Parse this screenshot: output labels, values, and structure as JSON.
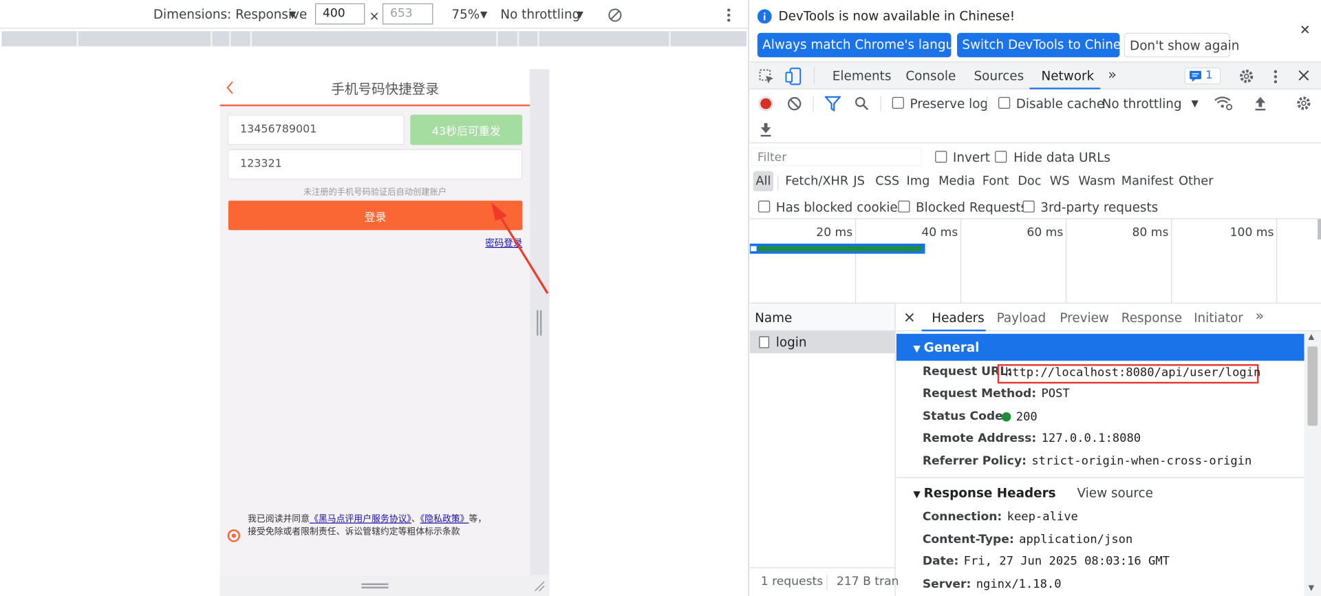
{
  "device_toolbar": {
    "dimensions_label": "Dimensions: Responsive",
    "width": "400",
    "height_placeholder": "653",
    "times": "×",
    "zoom": "75%",
    "throttling": "No throttling"
  },
  "mobile_page": {
    "title": "手机号码快捷登录",
    "phone": "13456789001",
    "resend_button": "43秒后可重发",
    "code": "123321",
    "hint": "未注册的手机号码验证后自动创建账户",
    "login_button": "登录",
    "password_login_link": "密码登录",
    "agreement": {
      "prefix": "我已阅读并同意",
      "link1": "《黑马点评用户服务协议》",
      "sep": "、",
      "link2": "《隐私政策》",
      "suffix": "等，",
      "line2": "接受免除或者限制责任、诉讼管辖约定等粗体标示条款"
    }
  },
  "devtools": {
    "notice": {
      "text": "DevTools is now available in Chinese!",
      "btn_match": "Always match Chrome's language",
      "btn_switch": "Switch DevTools to Chinese",
      "btn_dismiss": "Don't show again"
    },
    "tabs": [
      "Elements",
      "Console",
      "Sources",
      "Network"
    ],
    "active_tab": "Network",
    "issues_count": "1",
    "toolbar": {
      "preserve_log": "Preserve log",
      "disable_cache": "Disable cache",
      "throttling": "No throttling"
    },
    "filter": {
      "placeholder": "Filter",
      "invert": "Invert",
      "hide_data_urls": "Hide data URLs",
      "types": [
        "All",
        "Fetch/XHR",
        "JS",
        "CSS",
        "Img",
        "Media",
        "Font",
        "Doc",
        "WS",
        "Wasm",
        "Manifest",
        "Other"
      ],
      "has_blocked_cookies": "Has blocked cookies",
      "blocked_requests": "Blocked Requests",
      "third_party": "3rd-party requests"
    },
    "timeline_ticks": [
      "20 ms",
      "40 ms",
      "60 ms",
      "80 ms",
      "100 ms"
    ],
    "name_header": "Name",
    "requests": [
      "login"
    ],
    "status_bar": {
      "requests": "1 requests",
      "transfer": "217 B tran"
    },
    "detail_tabs": [
      "Headers",
      "Payload",
      "Preview",
      "Response",
      "Initiator"
    ],
    "general": {
      "title": "General",
      "request_url_label": "Request URL:",
      "request_url": "http://localhost:8080/api/user/login",
      "request_method_label": "Request Method:",
      "request_method": "POST",
      "status_code_label": "Status Code:",
      "status_code": "200",
      "remote_address_label": "Remote Address:",
      "remote_address": "127.0.0.1:8080",
      "referrer_policy_label": "Referrer Policy:",
      "referrer_policy": "strict-origin-when-cross-origin"
    },
    "response_headers": {
      "title": "Response Headers",
      "view_source": "View source",
      "connection_label": "Connection:",
      "connection": "keep-alive",
      "content_type_label": "Content-Type:",
      "content_type": "application/json",
      "date_label": "Date:",
      "date": "Fri, 27 Jun 2025 08:03:16 GMT",
      "server_label": "Server:",
      "server": "nginx/1.18.0"
    },
    "colors": {
      "accent": "#1a73e8",
      "highlight_box": "#e53935",
      "status_ok": "#1e8e3e"
    }
  }
}
